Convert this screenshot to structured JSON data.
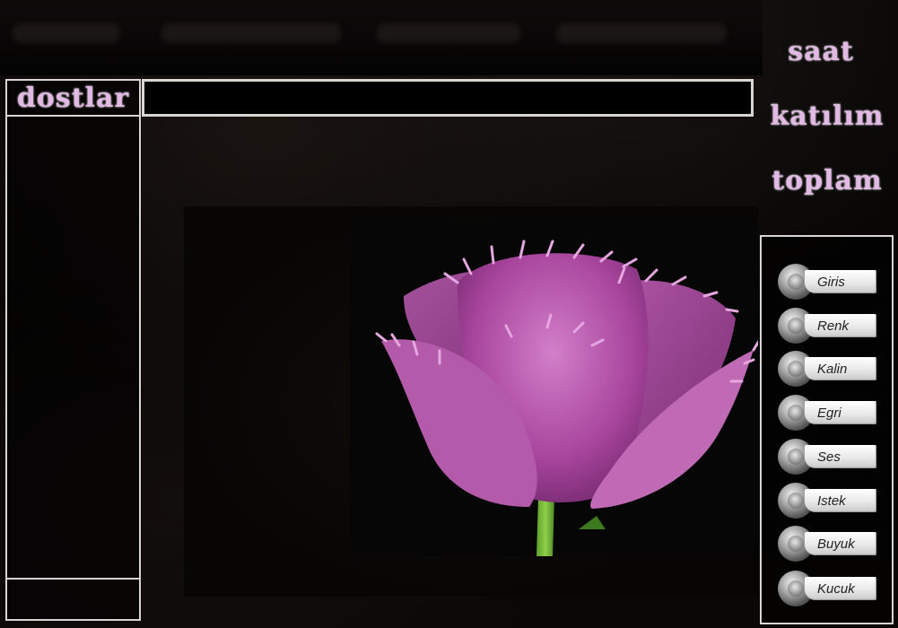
{
  "left_panel": {
    "title": "dostlar",
    "items": []
  },
  "message_bar": {
    "value": "",
    "placeholder": ""
  },
  "stats": {
    "saat": "saat",
    "katilim": "katılım",
    "toplam": "toplam"
  },
  "nav_buttons": [
    {
      "label": "Giris"
    },
    {
      "label": "Renk"
    },
    {
      "label": "Kalin"
    },
    {
      "label": "Egri"
    },
    {
      "label": "Ses"
    },
    {
      "label": "Istek"
    },
    {
      "label": "Buyuk"
    },
    {
      "label": "Kucuk"
    }
  ],
  "photo": {
    "subject": "purple fringed tulip"
  },
  "colors": {
    "accent": "#e2b8e4",
    "frame": "#d8d4d4",
    "background": "#050404"
  }
}
